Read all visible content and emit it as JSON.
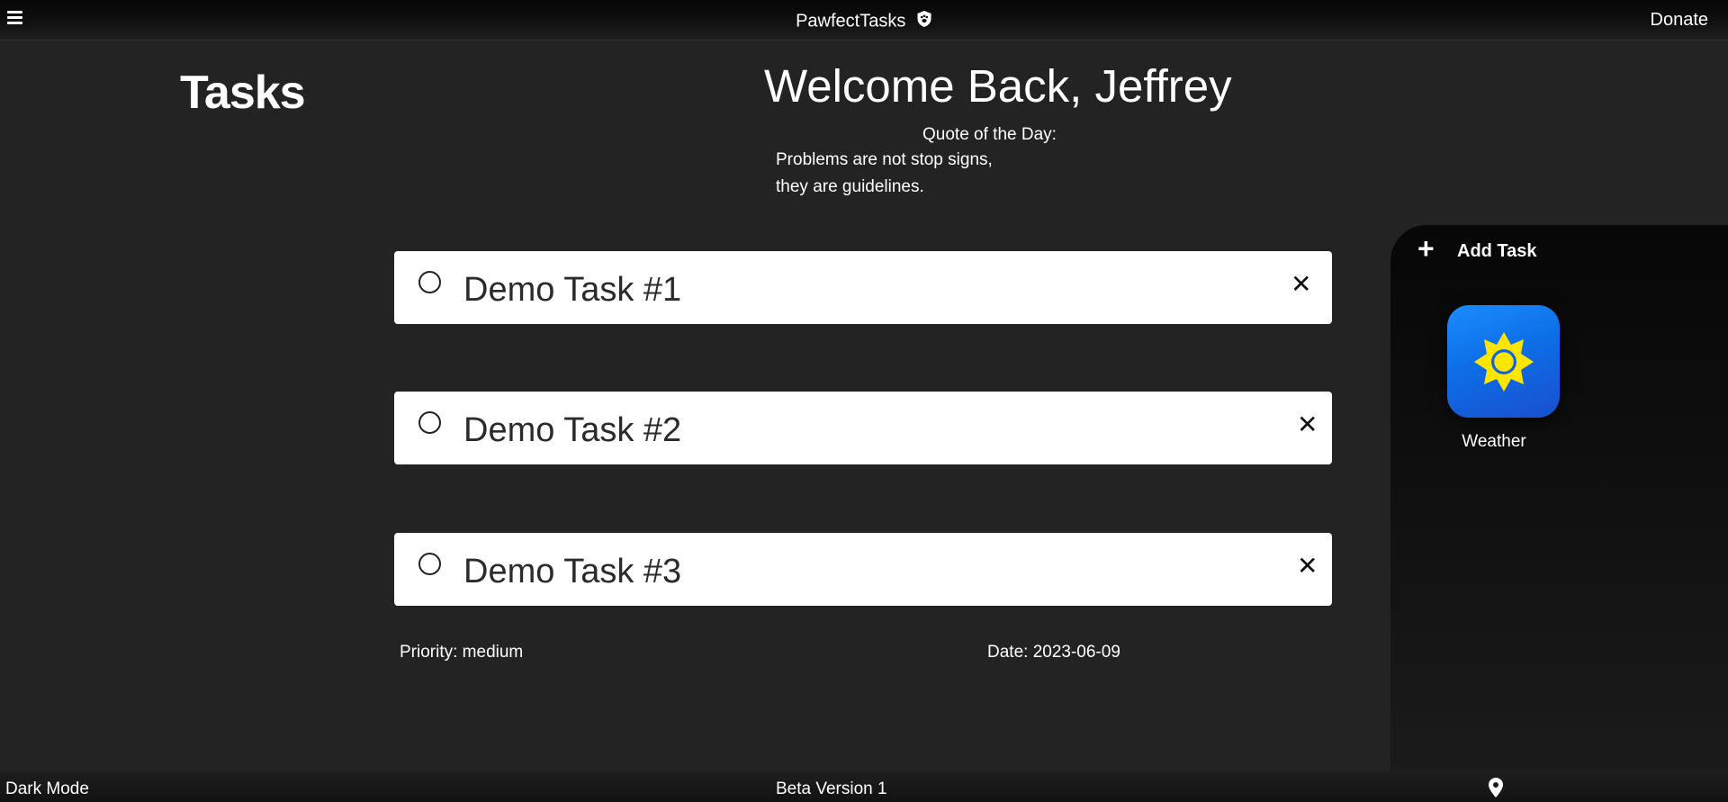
{
  "header": {
    "menu_icon": "hamburger-menu-icon",
    "app_title": "PawfectTasks",
    "title_icon": "paw-shield-icon",
    "donate_label": "Donate"
  },
  "page": {
    "tasks_heading": "Tasks",
    "welcome": "Welcome Back, Jeffrey",
    "quote_label": "Quote of the Day:",
    "quote_line1": "Problems are not stop signs,",
    "quote_line2": "they are guidelines."
  },
  "tasks": [
    {
      "name": "Demo Task #1",
      "checkbox_icon": "circle-checkbox-icon",
      "remove_icon": "close-icon"
    },
    {
      "name": "Demo Task #2",
      "checkbox_icon": "circle-checkbox-icon",
      "remove_icon": "close-icon"
    },
    {
      "name": "Demo Task #3",
      "checkbox_icon": "circle-checkbox-icon",
      "remove_icon": "close-icon"
    }
  ],
  "details": {
    "priority": "Priority: medium",
    "date": "Date: 2023-06-09"
  },
  "side_panel": {
    "add_icon": "plus-icon",
    "add_task_label": "Add Task",
    "apps": [
      {
        "label": "Weather",
        "icon": "sun-icon",
        "colors": {
          "tile": "#0d6ee6",
          "sun": "#ffe600"
        }
      }
    ]
  },
  "footer": {
    "dark_mode_label": "Dark Mode",
    "version": "Beta Version 1",
    "location_icon": "map-pin-icon"
  },
  "colors": {
    "background": "#232323",
    "card": "#ffffff",
    "text": "#ffffff"
  }
}
